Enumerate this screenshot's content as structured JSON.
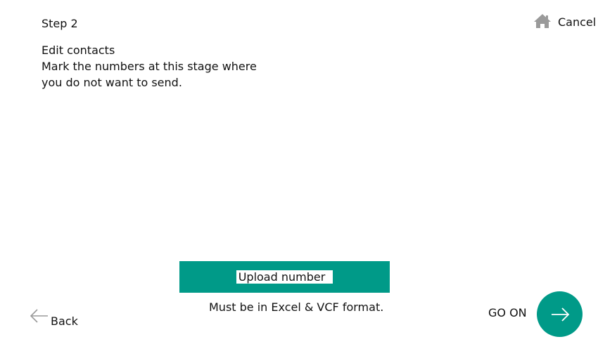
{
  "header": {
    "step": "Step 2",
    "cancel_label": "Cancel",
    "cancel_icon": "home-icon"
  },
  "instructions": {
    "lines": [
      "Edit contacts",
      "Mark the numbers at this stage where",
      "you do not want to send."
    ]
  },
  "upload": {
    "button_label": "Upload number",
    "format_note": "Must be in Excel & VCF format."
  },
  "footer": {
    "back_label": "Back",
    "back_icon": "arrow-left-icon",
    "go_on_label": "GO ON",
    "go_on_icon": "arrow-right-icon"
  },
  "colors": {
    "accent": "#009a88",
    "icon_gray": "#9a9a9a",
    "text": "#111111"
  }
}
